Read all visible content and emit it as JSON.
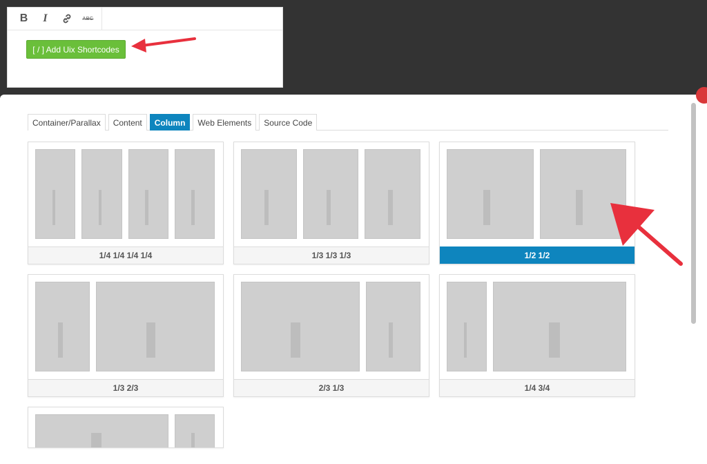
{
  "editor": {
    "toolbar": {
      "bold": "B",
      "italic": "I",
      "strike": "ABC"
    },
    "shortcode_button": "[ / ] Add Uix Shortcodes"
  },
  "modal": {
    "tabs": [
      {
        "label": "Container/Parallax",
        "active": false
      },
      {
        "label": "Content",
        "active": false
      },
      {
        "label": "Column",
        "active": true
      },
      {
        "label": "Web Elements",
        "active": false
      },
      {
        "label": "Source Code",
        "active": false
      }
    ],
    "layouts": [
      {
        "label": "1/4 1/4 1/4 1/4",
        "selected": false
      },
      {
        "label": "1/3 1/3 1/3",
        "selected": false
      },
      {
        "label": "1/2 1/2",
        "selected": true
      },
      {
        "label": "1/3 2/3",
        "selected": false
      },
      {
        "label": "2/3 1/3",
        "selected": false
      },
      {
        "label": "1/4 3/4",
        "selected": false
      }
    ]
  },
  "colors": {
    "accent": "#0e85be",
    "button_green": "#6abf3a",
    "annotation_red": "#e8303d"
  }
}
